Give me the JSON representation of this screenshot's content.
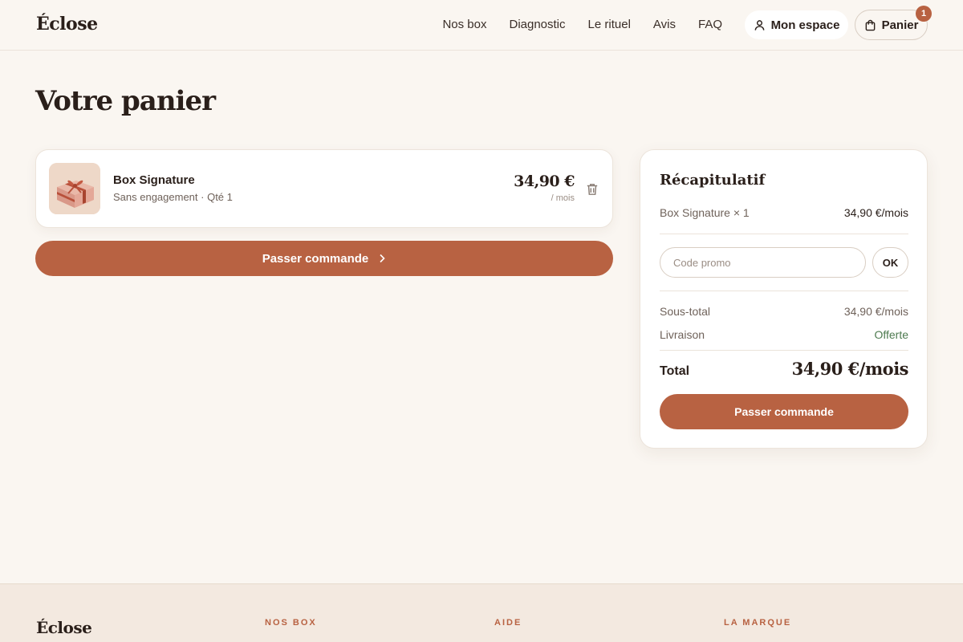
{
  "brand": {
    "name": "Éclose"
  },
  "nav": {
    "items": [
      {
        "label": "Nos box"
      },
      {
        "label": "Diagnostic"
      },
      {
        "label": "Le rituel"
      },
      {
        "label": "Avis"
      },
      {
        "label": "FAQ"
      }
    ],
    "account_label": "Mon espace",
    "cart_label": "Panier",
    "cart_count": "1"
  },
  "page": {
    "title": "Votre panier"
  },
  "cart": {
    "items": [
      {
        "name": "Box Signature",
        "details": "Sans engagement · Qté 1",
        "price": "34,90 €",
        "period": "/ mois"
      }
    ],
    "checkout_label": "Passer commande"
  },
  "summary": {
    "title": "Récapitulatif",
    "line_label": "Box Signature × 1",
    "line_value": "34,90 €/mois",
    "promo_placeholder": "Code promo",
    "promo_button": "OK",
    "subtotal_label": "Sous-total",
    "subtotal_value": "34,90 €/mois",
    "shipping_label": "Livraison",
    "shipping_value": "Offerte",
    "total_label": "Total",
    "total_value": "34,90 €/mois",
    "checkout_label": "Passer commande"
  },
  "footer": {
    "brand": "Éclose",
    "columns": [
      {
        "heading": "NOS BOX"
      },
      {
        "heading": "AIDE"
      },
      {
        "heading": "LA MARQUE"
      }
    ]
  },
  "colors": {
    "accent": "#b86242",
    "background": "#faf6f1",
    "success": "#4d7a4f"
  },
  "icons": {
    "account": "user-icon",
    "cart": "shopping-bag-icon",
    "delete": "trash-icon",
    "arrow": "chevron-right-icon"
  }
}
